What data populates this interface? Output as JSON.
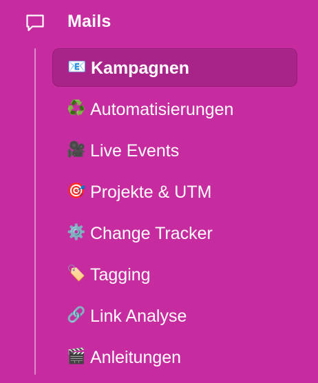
{
  "section": {
    "title": "Mails",
    "icon": "chat-bubble-icon"
  },
  "colors": {
    "background": "#c72ba0",
    "active_item": "#a92488",
    "text": "#ffffff"
  },
  "nav": {
    "items": [
      {
        "emoji": "📧",
        "icon": "envelope-icon",
        "label": "Kampagnen",
        "active": true
      },
      {
        "emoji": "♻️",
        "icon": "recycle-icon",
        "label": "Automatisierungen",
        "active": false
      },
      {
        "emoji": "🎥",
        "icon": "movie-camera-icon",
        "label": "Live Events",
        "active": false
      },
      {
        "emoji": "🎯",
        "icon": "target-icon",
        "label": "Projekte & UTM",
        "active": false
      },
      {
        "emoji": "⚙️",
        "icon": "gear-icon",
        "label": "Change Tracker",
        "active": false
      },
      {
        "emoji": "🏷️",
        "icon": "label-tag-icon",
        "label": "Tagging",
        "active": false
      },
      {
        "emoji": "🔗",
        "icon": "link-icon",
        "label": "Link Analyse",
        "active": false
      },
      {
        "emoji": "🎬",
        "icon": "clapper-board-icon",
        "label": "Anleitungen",
        "active": false
      }
    ]
  }
}
